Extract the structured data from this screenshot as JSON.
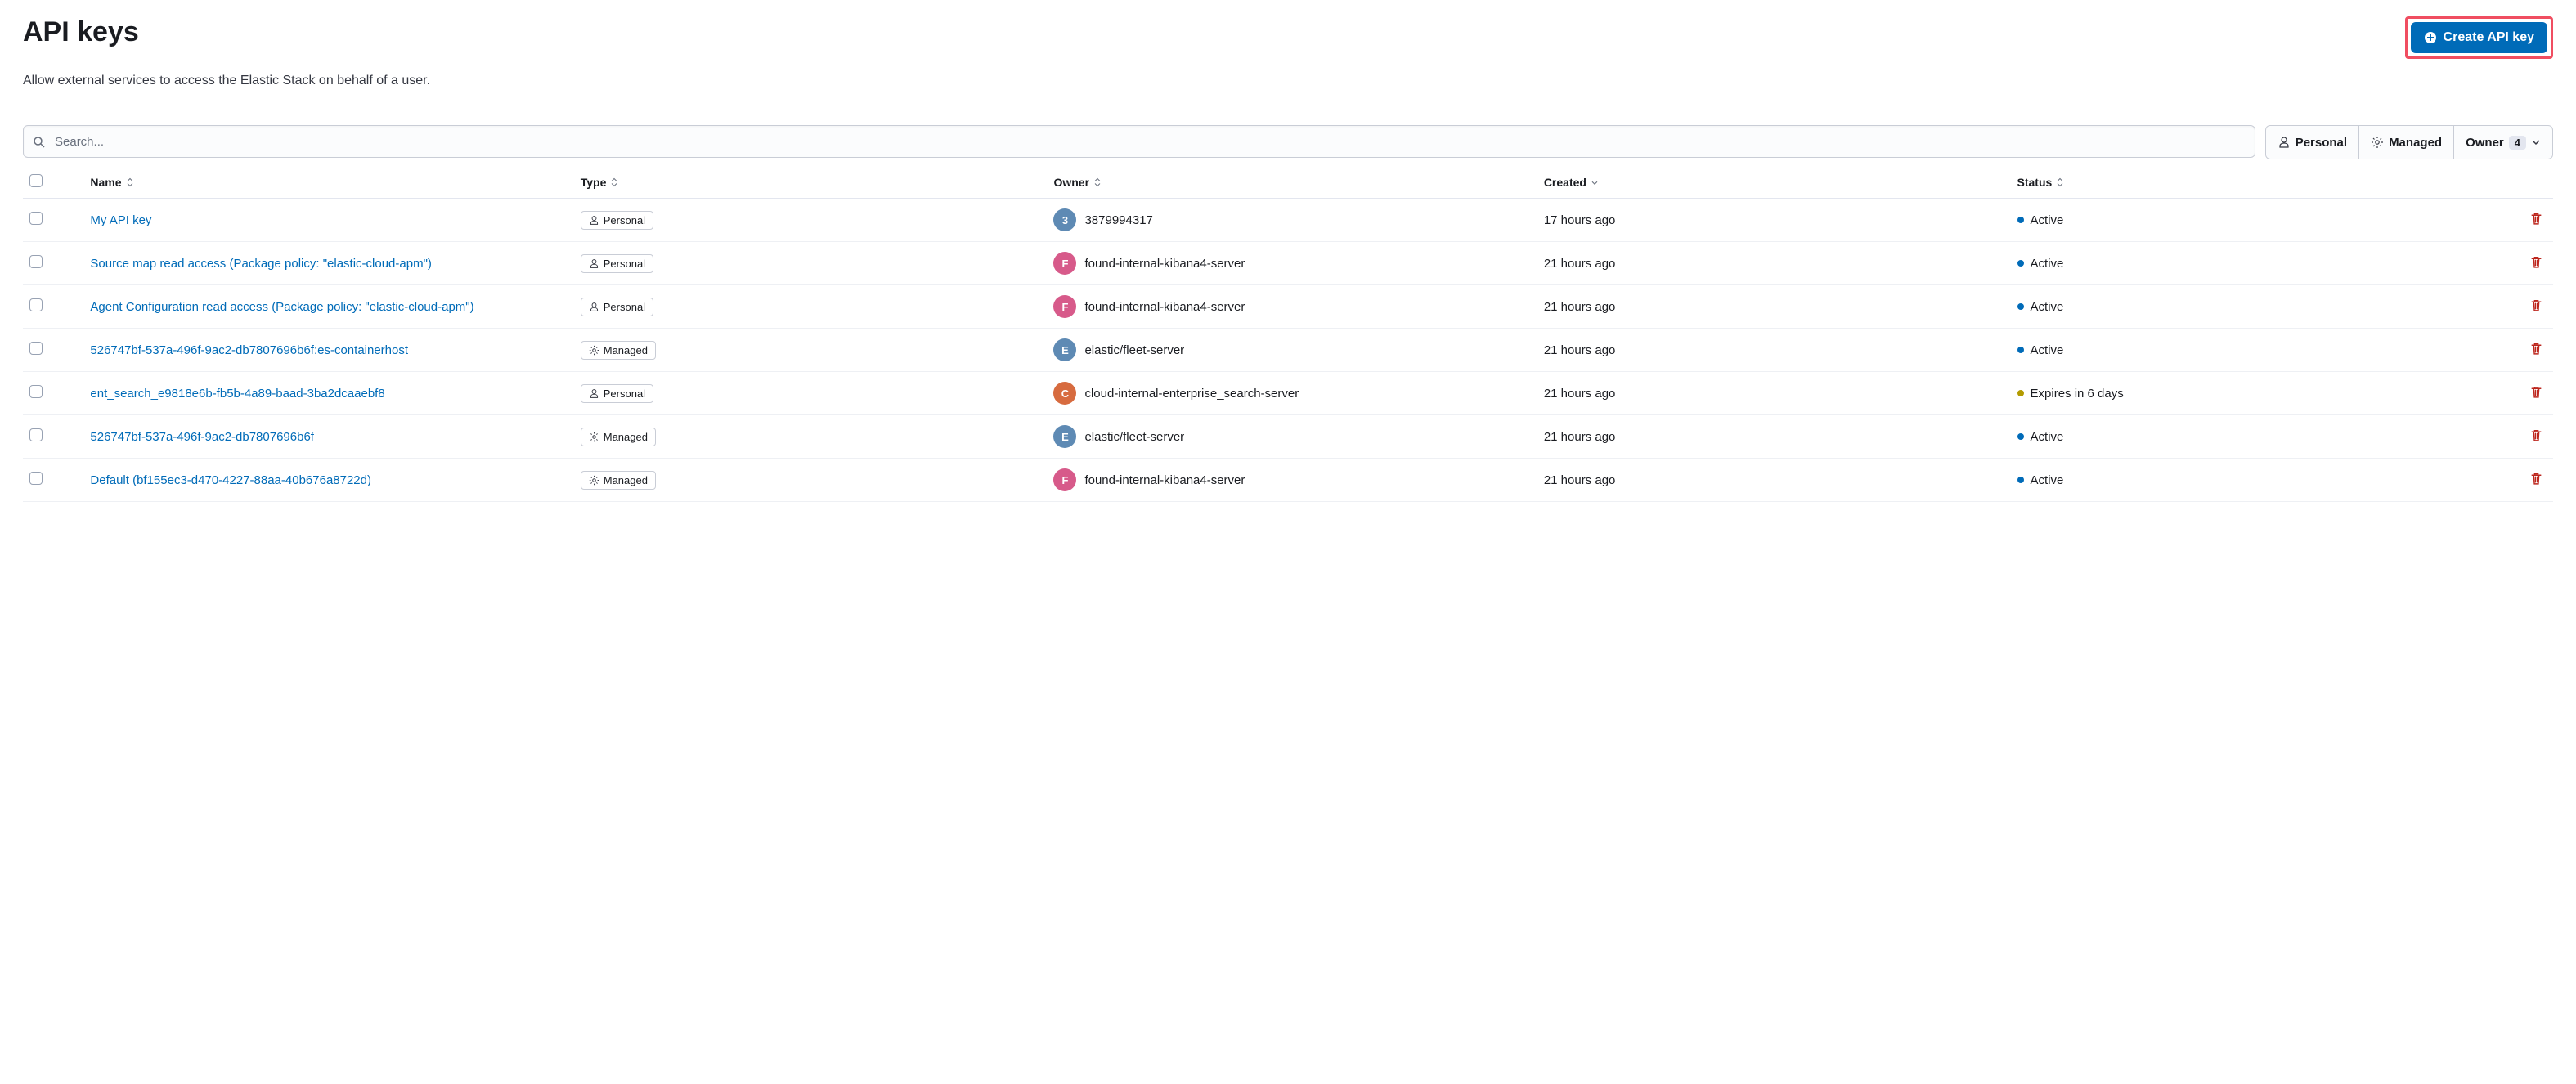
{
  "header": {
    "title": "API keys",
    "create_button": "Create API key",
    "subtitle": "Allow external services to access the Elastic Stack on behalf of a user."
  },
  "search": {
    "placeholder": "Search..."
  },
  "filters": {
    "personal": "Personal",
    "managed": "Managed",
    "owner": "Owner",
    "owner_count": "4"
  },
  "columns": {
    "name": "Name",
    "type": "Type",
    "owner": "Owner",
    "created": "Created",
    "status": "Status"
  },
  "type_labels": {
    "personal": "Personal",
    "managed": "Managed"
  },
  "status_colors": {
    "active": "#006bb8",
    "expires": "#b39b00"
  },
  "avatar_colors": {
    "blue": "#5e8ab4",
    "pink": "#d75a8a",
    "orange": "#d76b3f"
  },
  "rows": [
    {
      "name": "My API key",
      "type": "personal",
      "owner": "3879994317",
      "avatar_letter": "3",
      "avatar_color": "blue",
      "created": "17 hours ago",
      "status_label": "Active",
      "status_kind": "active"
    },
    {
      "name": "Source map read access (Package policy: \"elastic-cloud-apm\")",
      "type": "personal",
      "owner": "found-internal-kibana4-server",
      "avatar_letter": "F",
      "avatar_color": "pink",
      "created": "21 hours ago",
      "status_label": "Active",
      "status_kind": "active"
    },
    {
      "name": "Agent Configuration read access (Package policy: \"elastic-cloud-apm\")",
      "type": "personal",
      "owner": "found-internal-kibana4-server",
      "avatar_letter": "F",
      "avatar_color": "pink",
      "created": "21 hours ago",
      "status_label": "Active",
      "status_kind": "active"
    },
    {
      "name": "526747bf-537a-496f-9ac2-db7807696b6f:es-containerhost",
      "type": "managed",
      "owner": "elastic/fleet-server",
      "avatar_letter": "E",
      "avatar_color": "blue",
      "created": "21 hours ago",
      "status_label": "Active",
      "status_kind": "active"
    },
    {
      "name": "ent_search_e9818e6b-fb5b-4a89-baad-3ba2dcaaebf8",
      "type": "personal",
      "owner": "cloud-internal-enterprise_search-server",
      "avatar_letter": "C",
      "avatar_color": "orange",
      "created": "21 hours ago",
      "status_label": "Expires in 6 days",
      "status_kind": "expires"
    },
    {
      "name": "526747bf-537a-496f-9ac2-db7807696b6f",
      "type": "managed",
      "owner": "elastic/fleet-server",
      "avatar_letter": "E",
      "avatar_color": "blue",
      "created": "21 hours ago",
      "status_label": "Active",
      "status_kind": "active"
    },
    {
      "name": "Default (bf155ec3-d470-4227-88aa-40b676a8722d)",
      "type": "managed",
      "owner": "found-internal-kibana4-server",
      "avatar_letter": "F",
      "avatar_color": "pink",
      "created": "21 hours ago",
      "status_label": "Active",
      "status_kind": "active"
    }
  ]
}
